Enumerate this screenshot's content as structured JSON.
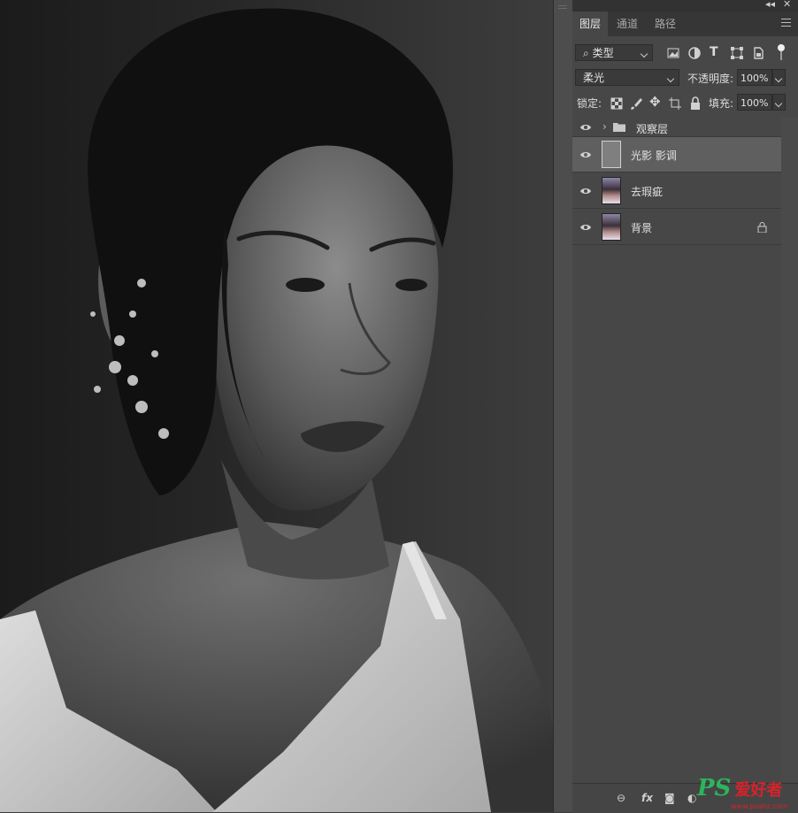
{
  "panel_tabs": [
    "图层",
    "通道",
    "路径"
  ],
  "filter": {
    "kind_label": "类型"
  },
  "blend": {
    "mode": "柔光",
    "opacity_label": "不透明度:",
    "opacity_value": "100%"
  },
  "lock": {
    "label": "锁定:",
    "fill_label": "填充:",
    "fill_value": "100%"
  },
  "layers": [
    {
      "name": "观察层",
      "type": "group",
      "visible": true,
      "selected": false
    },
    {
      "name": "光影 影调",
      "type": "fill",
      "visible": true,
      "selected": true
    },
    {
      "name": "去瑕疵",
      "type": "photo",
      "visible": true,
      "selected": false
    },
    {
      "name": "背景",
      "type": "photo",
      "visible": true,
      "selected": false,
      "locked": true
    }
  ],
  "bottom_icons": [
    "link-icon",
    "fx-icon",
    "mask-icon",
    "adjustment-icon",
    "group-icon",
    "new-layer-icon",
    "trash-icon"
  ],
  "bottom_fx_label": "fx",
  "watermark": {
    "brand": "PS",
    "text": "爱好者",
    "url": "www.psahz.com"
  },
  "colors": {
    "panel": "#474747",
    "selected_layer": "#5f5f5f",
    "accent_green": "#2bb55d",
    "watermark_red": "#d9222a"
  }
}
